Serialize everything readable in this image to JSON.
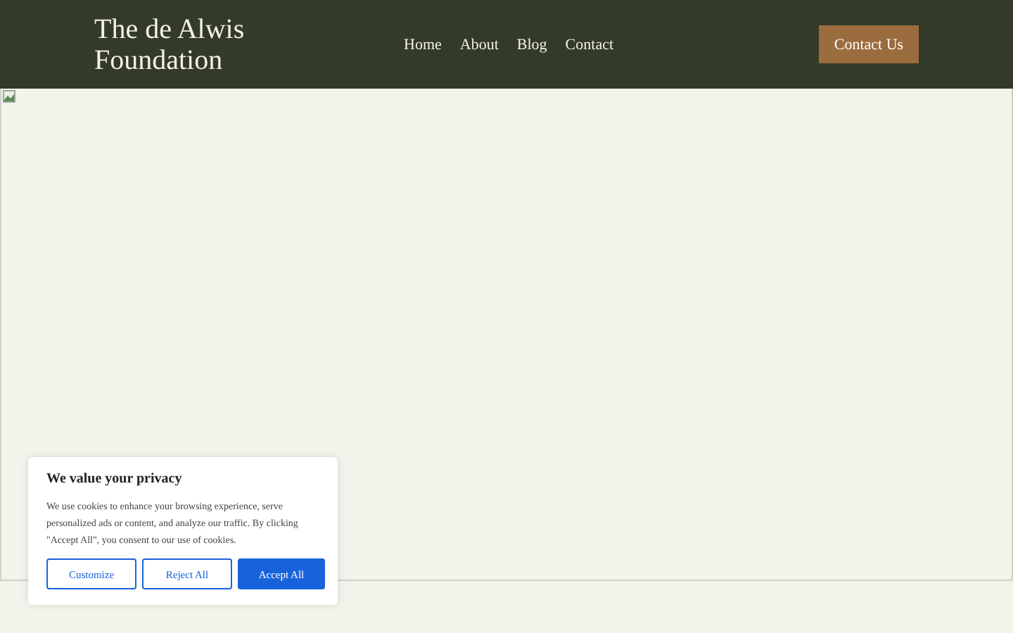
{
  "header": {
    "logo": "The de Alwis Foundation",
    "nav": [
      {
        "label": "Home"
      },
      {
        "label": "About"
      },
      {
        "label": "Blog"
      },
      {
        "label": "Contact"
      }
    ],
    "cta": "Contact Us"
  },
  "cookie_banner": {
    "title": "We value your privacy",
    "text": "We use cookies to enhance your browsing experience, serve personalized ads or content, and analyze our traffic. By clicking \"Accept All\", you consent to our use of cookies.",
    "buttons": [
      {
        "label": "Customize",
        "kind": "outline"
      },
      {
        "label": "Reject All",
        "kind": "outline"
      },
      {
        "label": "Accept All",
        "kind": "primary"
      }
    ]
  }
}
